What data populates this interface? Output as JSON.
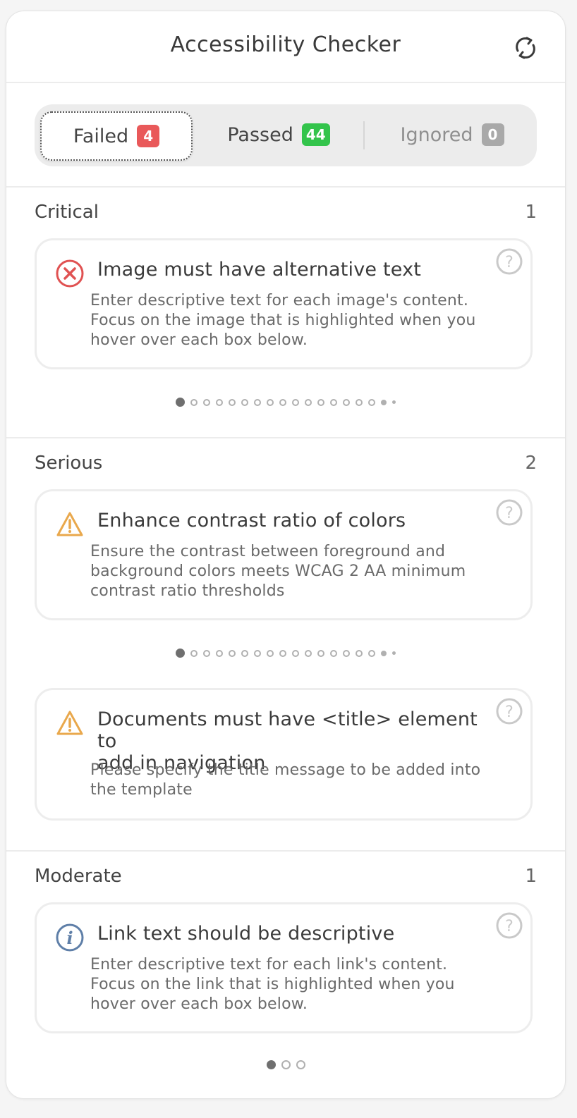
{
  "header": {
    "title": "Accessibility Checker"
  },
  "tabs": [
    {
      "label": "Failed",
      "count": "4",
      "color": "#e9595a"
    },
    {
      "label": "Passed",
      "count": "44",
      "color": "#33c44b"
    },
    {
      "label": "Ignored",
      "count": "0",
      "color": "#a9a9a9"
    }
  ],
  "sections": {
    "critical": {
      "label": "Critical",
      "count": "1",
      "cards": [
        {
          "icon": "error-x-icon",
          "title": "Image must have alternative text",
          "desc_lines": [
            "Enter descriptive text for each image's content.",
            "Focus on the image that is highlighted when you",
            "hover over each box below."
          ]
        }
      ]
    },
    "serious": {
      "label": "Serious",
      "count": "2",
      "cards": [
        {
          "icon": "warning-triangle-icon",
          "title": "Enhance contrast ratio of colors",
          "desc_lines": [
            "Ensure the contrast between foreground and",
            "background colors meets WCAG 2 AA minimum",
            "contrast ratio thresholds"
          ]
        },
        {
          "icon": "warning-triangle-icon",
          "title_lines": [
            "Documents must have <title> element to",
            "add in navigation"
          ],
          "desc_lines": [
            "Please specify the title message to be added into",
            "the template"
          ]
        }
      ]
    },
    "moderate": {
      "label": "Moderate",
      "count": "1",
      "cards": [
        {
          "icon": "info-i-icon",
          "title": "Link text should be descriptive",
          "desc_lines": [
            "Enter descriptive text for each link's content.",
            "Focus on the link that is highlighted when you",
            "hover over each box below."
          ]
        }
      ]
    }
  },
  "colors": {
    "error": "#e05252",
    "warning": "#e9a84c",
    "info": "#5f7fa8"
  }
}
